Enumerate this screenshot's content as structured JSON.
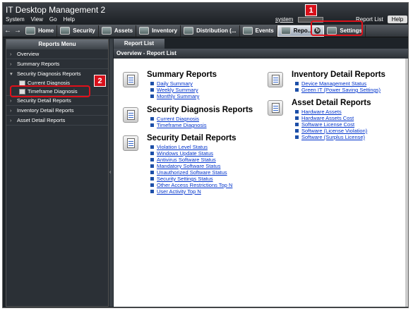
{
  "app": {
    "title": "IT Desktop Management 2"
  },
  "menu": [
    "System",
    "View",
    "Go",
    "Help"
  ],
  "user": {
    "name": "system"
  },
  "topbar": {
    "report_list": "Report List",
    "help": "Help"
  },
  "nav": {
    "tabs": [
      {
        "label": "Home"
      },
      {
        "label": "Security"
      },
      {
        "label": "Assets"
      },
      {
        "label": "Inventory"
      },
      {
        "label": "Distribution (..."
      },
      {
        "label": "Events"
      },
      {
        "label": "Repo..."
      },
      {
        "label": "Settings"
      }
    ]
  },
  "sidebar": {
    "title": "Reports Menu",
    "items": [
      {
        "label": "Overview"
      },
      {
        "label": "Summary Reports"
      },
      {
        "label": "Security Diagnosis Reports"
      },
      {
        "label": "Security Detail Reports"
      },
      {
        "label": "Inventory Detail Reports"
      },
      {
        "label": "Asset Detail Reports"
      }
    ],
    "subitems": [
      {
        "label": "Current Diagnosis"
      },
      {
        "label": "Timeframe Diagnosis"
      }
    ]
  },
  "content": {
    "tab": "Report List",
    "breadcrumb": "Overview - Report List",
    "sections": {
      "summary": {
        "title": "Summary Reports",
        "links": [
          "Daily Summary",
          "Weekly Summary",
          "Monthly Summary"
        ]
      },
      "diagnosis": {
        "title": "Security Diagnosis Reports",
        "links": [
          "Current Diagnosis",
          "Timeframe Diagnosis"
        ]
      },
      "detail": {
        "title": "Security Detail Reports",
        "links": [
          "Violation Level Status",
          "Windows Update Status",
          "Antivirus Software Status",
          "Mandatory Software Status",
          "Unauthorized Software Status",
          "Security Settings Status",
          "Other Access Restrictions Top N",
          "User Activity Top N"
        ]
      },
      "inventory": {
        "title": "Inventory Detail Reports",
        "links": [
          "Device Management Status",
          "Green IT (Power Saving Settings)"
        ]
      },
      "asset": {
        "title": "Asset Detail Reports",
        "links": [
          "Hardware Assets",
          "Hardware Assets Cost",
          "Software License Cost",
          "Software (License Violation)",
          "Software (Surplus License)"
        ]
      }
    }
  },
  "callouts": [
    "1",
    "2"
  ],
  "colors": {
    "accent": "#e0101a",
    "link": "#0033cc"
  }
}
